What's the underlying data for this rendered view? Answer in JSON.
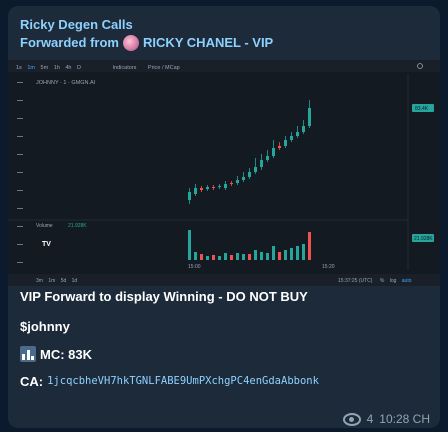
{
  "header": {
    "sender": "Ricky Degen Calls",
    "forwarded_prefix": "Forwarded from",
    "forwarded_source": "RICKY CHANEL - VIP"
  },
  "chart": {
    "toolbar_items": [
      "1s",
      "1m",
      "5m",
      "1h",
      "4h",
      "D",
      "Indicators",
      "Price / MCap"
    ],
    "symbol_title": "JOHNNY · 1 · GMGN.AI",
    "price_tag": "83.4K",
    "volume_label": "Volume",
    "volume_value": "21.928K",
    "volume_tag": "21.928K",
    "time_labels": [
      "15:00",
      "15:20"
    ],
    "bottom_left": [
      "3m",
      "1m",
      "5d",
      "1d"
    ],
    "bottom_right": [
      "15:37:25 (UTC)",
      "%",
      "log",
      "auto"
    ],
    "candles_up_color": "#26a69a",
    "candles_down_color": "#ef5350"
  },
  "chart_data": {
    "type": "candlestick",
    "title": "JOHNNY · 1 · GMGN.AI",
    "unit": "MCap",
    "last_value": "83.4K",
    "volume_last": "21.928K"
  },
  "message": {
    "headline": "VIP Forward to display Winning - DO NOT BUY",
    "ticker": "$johnny",
    "mc_label": "MC: 83K",
    "ca_label": "CA:",
    "ca_value": "1jcqcbheVH7hkTGNLFABE9UmPXchgPC4enGdaAbbonk"
  },
  "footer": {
    "views": "4",
    "time": "10:28 CH"
  }
}
